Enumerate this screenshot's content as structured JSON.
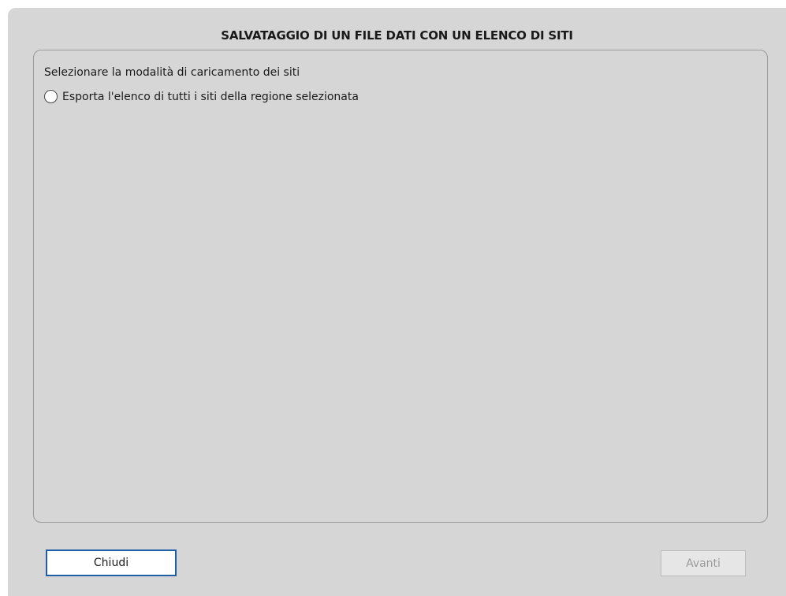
{
  "dialog": {
    "title": "SALVATAGGIO DI UN FILE DATI CON UN ELENCO DI SITI",
    "group": {
      "label": "Selezionare la modalità di caricamento dei siti",
      "options": [
        {
          "label": "Esporta l'elenco di tutti i siti della regione selezionata",
          "selected": false
        }
      ]
    },
    "buttons": {
      "close_label": "Chiudi",
      "next_label": "Avanti",
      "next_enabled": false
    }
  },
  "colors": {
    "dialog_background": "#d6d6d6",
    "focus_border": "#1f5fa8",
    "disabled_text": "#9a9a9a"
  }
}
